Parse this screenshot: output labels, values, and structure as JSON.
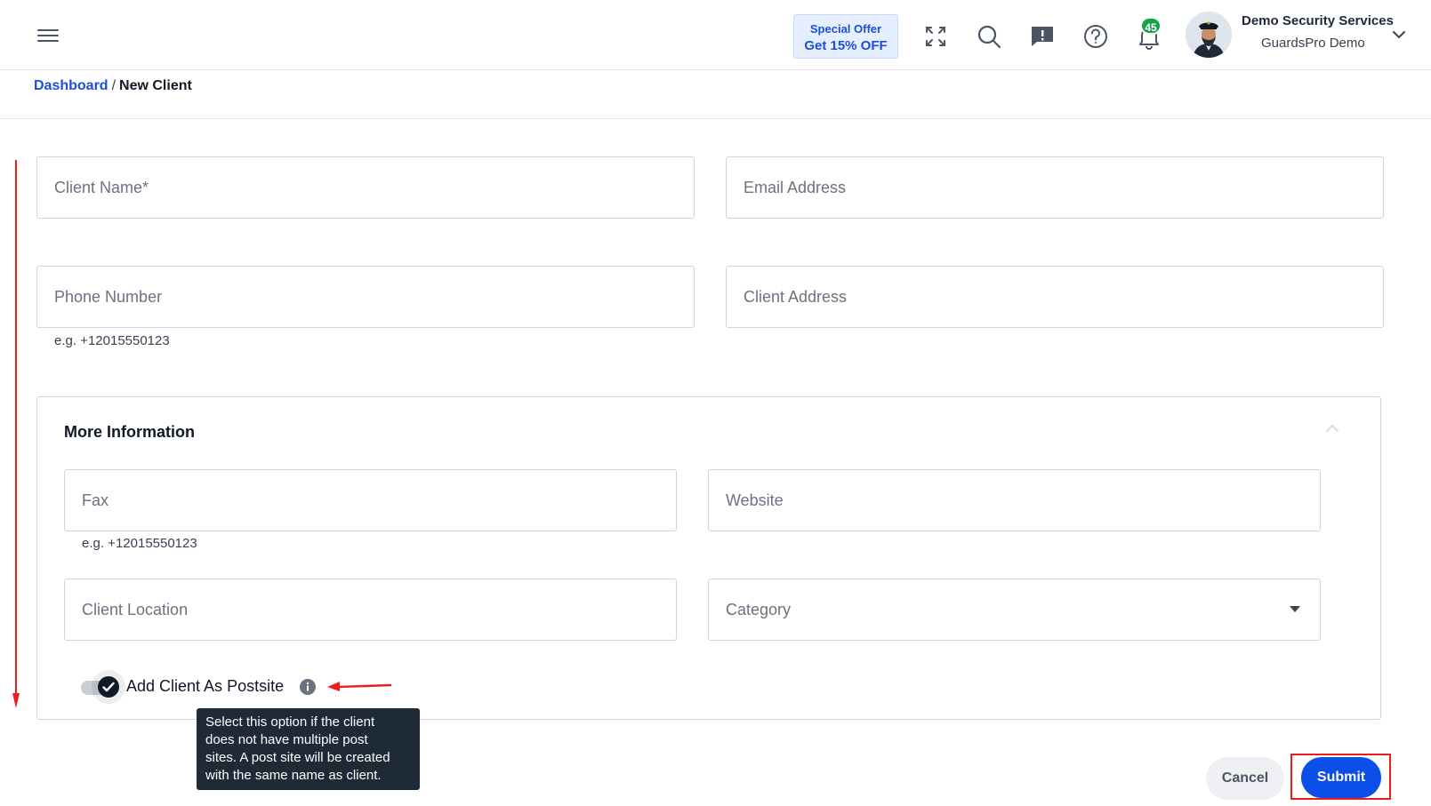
{
  "header": {
    "menu_icon": "hamburger-menu-icon",
    "offer": {
      "line1": "Special Offer",
      "line2": "Get 15% OFF"
    },
    "icons": [
      "fullscreen-icon",
      "search-icon",
      "feedback-icon",
      "help-icon",
      "bell-icon"
    ],
    "notification_count": "45",
    "user": {
      "name": "Demo Security Services",
      "org": "GuardsPro Demo"
    }
  },
  "breadcrumb": {
    "root": "Dashboard",
    "separator": "/",
    "current": "New Client"
  },
  "form": {
    "client_name": {
      "placeholder": "Client Name*"
    },
    "email": {
      "placeholder": "Email Address"
    },
    "phone": {
      "placeholder": "Phone Number",
      "hint": "e.g. +12015550123"
    },
    "address": {
      "placeholder": "Client Address"
    }
  },
  "more_info": {
    "title": "More Information",
    "fax": {
      "placeholder": "Fax",
      "hint": "e.g. +12015550123"
    },
    "website": {
      "placeholder": "Website"
    },
    "location": {
      "placeholder": "Client Location"
    },
    "category": {
      "placeholder": "Category"
    },
    "postsite_toggle": {
      "label": "Add Client As Postsite",
      "checked": true
    },
    "tooltip": [
      "Select this option if the client",
      "does not have multiple post",
      "sites. A post site will be created",
      "with the same name as client."
    ]
  },
  "actions": {
    "cancel": "Cancel",
    "submit": "Submit"
  },
  "colors": {
    "primary": "#0b4ee8",
    "link": "#1d4ed8",
    "annotation": "#ef1c1c",
    "badge": "#16a34a"
  }
}
